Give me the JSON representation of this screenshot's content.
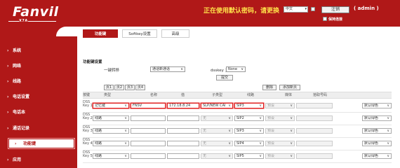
{
  "header": {
    "logo": "Fanvil",
    "model": "X7A",
    "warning": "正在使用默认密码，请更换",
    "language": "中文",
    "logout": "注销",
    "user": "( admin )",
    "keep_login": "保持连接"
  },
  "sidebar": {
    "items": [
      {
        "label": "系统"
      },
      {
        "label": "网络"
      },
      {
        "label": "线路"
      },
      {
        "label": "电话设置"
      },
      {
        "label": "电话本"
      },
      {
        "label": "通话记录"
      },
      {
        "label": "功能键",
        "active": true
      },
      {
        "label": "应用"
      }
    ]
  },
  "tabs": [
    {
      "label": "功能键",
      "active": true
    },
    {
      "label": "Softkey设置",
      "active": false
    },
    {
      "label": "高级",
      "active": false
    }
  ],
  "settings": {
    "title": "功能键设置",
    "transfer_label": "一键转移",
    "transfer_value": "通话新通话",
    "dsskey_label": "dsskey 主页:",
    "dsskey_value": "None",
    "submit": "提交"
  },
  "pages": [
    "页1",
    "页2",
    "页3",
    "页4"
  ],
  "actions": {
    "delete": "删除",
    "add": "添加新页"
  },
  "table": {
    "headers": [
      "按键",
      "类型",
      "名称",
      "值",
      "子类型",
      "线路",
      "媒体",
      "拾取号码"
    ],
    "rows": [
      {
        "key": "DSS Key 1",
        "type": "记忆键",
        "name": "FNSV",
        "value": "172.18.8.24",
        "subtype": "SLP/NEW CAI",
        "line": "SIP3",
        "media": "预设",
        "pickup": "",
        "color": "默认绿色"
      },
      {
        "key": "DSS Key 2",
        "type": "线路",
        "name": "",
        "value": "",
        "subtype": "无",
        "line": "SIP2",
        "media": "预设",
        "pickup": "",
        "color": "默认绿色"
      },
      {
        "key": "DSS Key 3",
        "type": "线路",
        "name": "",
        "value": "",
        "subtype": "无",
        "line": "SIP3",
        "media": "预设",
        "pickup": "",
        "color": "默认绿色"
      },
      {
        "key": "DSS Key 4",
        "type": "线路",
        "name": "",
        "value": "",
        "subtype": "无",
        "line": "SIP4",
        "media": "预设",
        "pickup": "",
        "color": "默认绿色"
      },
      {
        "key": "DSS Key 5",
        "type": "线路",
        "name": "",
        "value": "",
        "subtype": "无",
        "line": "SIP5",
        "media": "预设",
        "pickup": "",
        "color": "默认绿色"
      }
    ]
  },
  "colors": {
    "brand_red": "#b01818",
    "warning_yellow": "#ffe14a",
    "highlight_red": "#e02020"
  }
}
